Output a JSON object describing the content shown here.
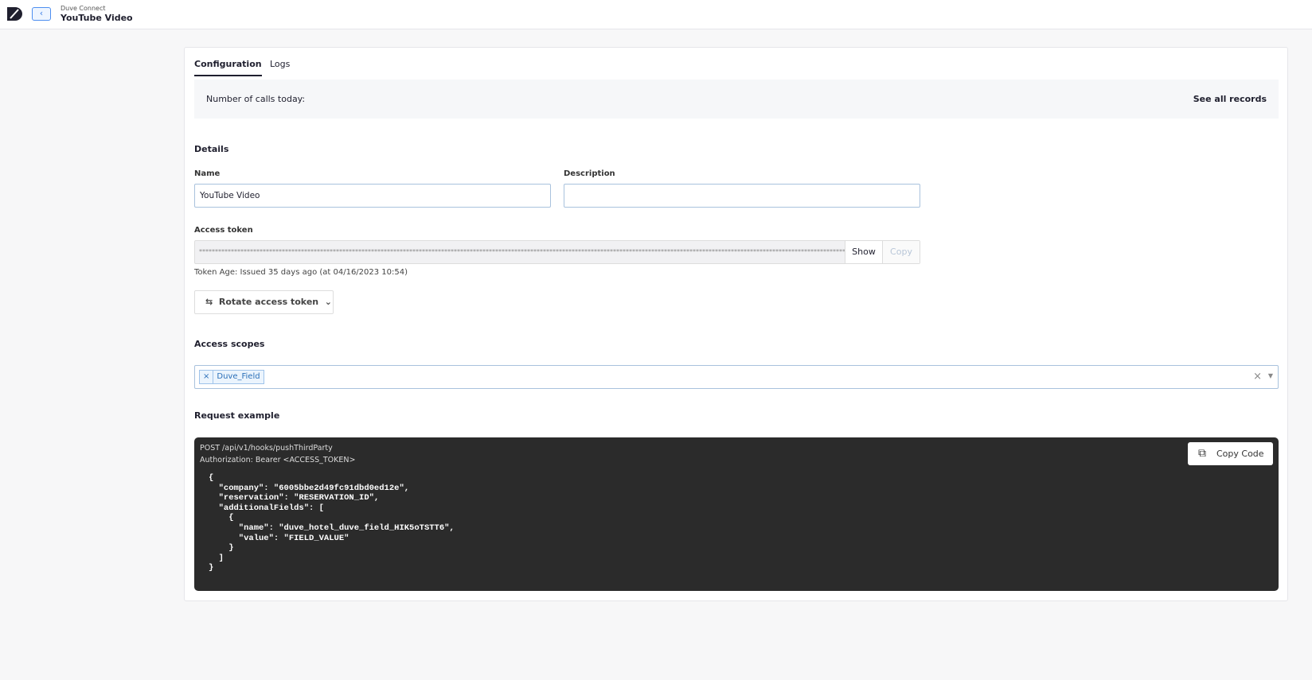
{
  "header": {
    "app": "Duve Connect",
    "title": "YouTube Video"
  },
  "tabs": [
    {
      "label": "Configuration"
    },
    {
      "label": "Logs"
    }
  ],
  "calls": {
    "label": "Number of calls today:",
    "link": "See all records"
  },
  "details": {
    "heading": "Details",
    "name_label": "Name",
    "name_value": "YouTube Video",
    "description_label": "Description",
    "description_value": "",
    "token_label": "Access token",
    "token_mask": "*****************************************************************************************************************************************************************************************************************",
    "show": "Show",
    "copy": "Copy",
    "token_age": "Token Age: Issued 35 days ago (at 04/16/2023 10:54)",
    "rotate": "Rotate access token"
  },
  "scopes": {
    "heading": "Access scopes",
    "chips": [
      "Duve_Field"
    ]
  },
  "request": {
    "heading": "Request example",
    "line1": "POST /api/v1/hooks/pushThirdParty",
    "line2": "Authorization: Bearer <ACCESS_TOKEN>",
    "body": "{\n  \"company\": \"6005bbe2d49fc91dbd0ed12e\",\n  \"reservation\": \"RESERVATION_ID\",\n  \"additionalFields\": [\n    {\n      \"name\": \"duve_hotel_duve_field_HIK5oTSTT6\",\n      \"value\": \"FIELD_VALUE\"\n    }\n  ]\n}",
    "copy_code": "Copy Code"
  }
}
